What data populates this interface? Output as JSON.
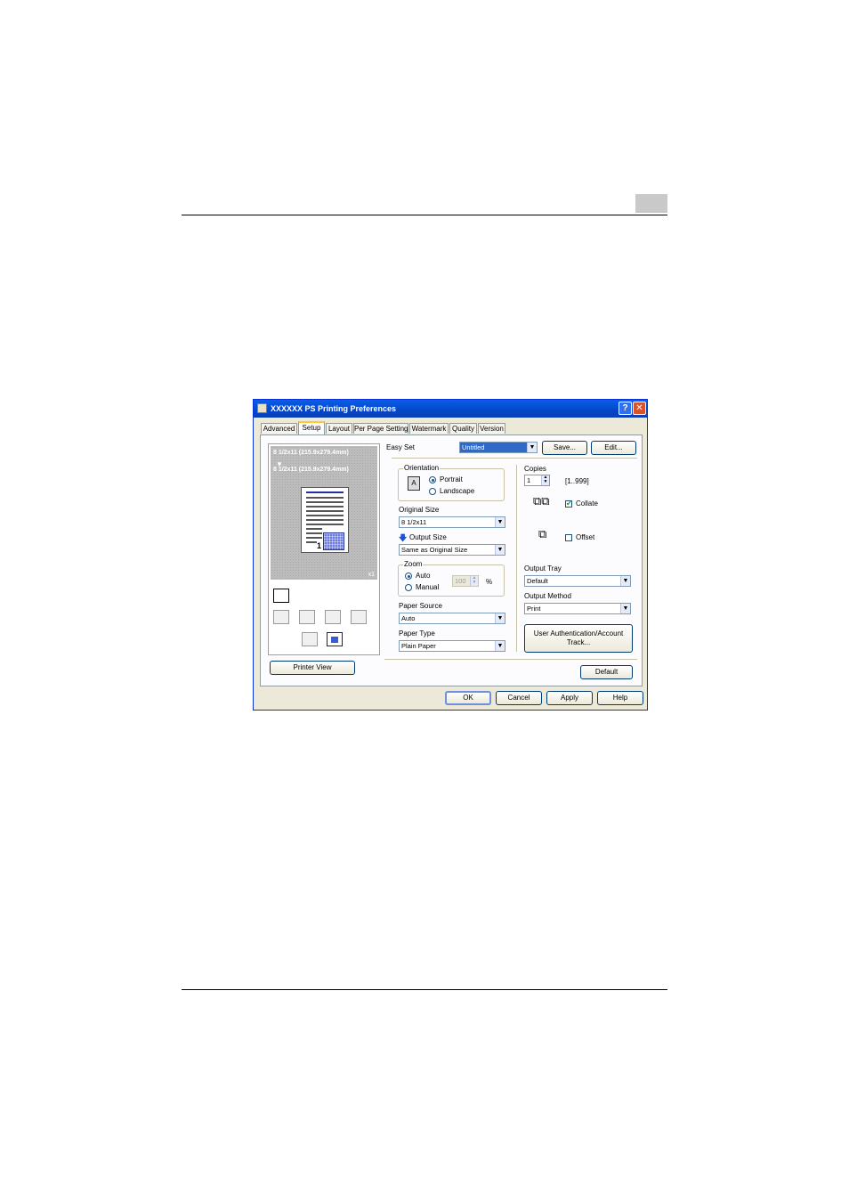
{
  "window": {
    "title": "XXXXXX  PS Printing Preferences",
    "help_button": "?",
    "close_button": "✕"
  },
  "tabs": [
    "Advanced",
    "Setup",
    "Layout",
    "Per Page Setting",
    "Watermark",
    "Quality",
    "Version"
  ],
  "active_tab": "Setup",
  "preview": {
    "original_line": "8 1/2x11 (215.9x279.4mm)",
    "arrow": "▼",
    "output_line": "8 1/2x11 (215.9x279.4mm)",
    "page_number": "1",
    "copies_marker": "x1",
    "printer_view_button": "Printer View"
  },
  "easy_set": {
    "label": "Easy Set",
    "value": "Untitled",
    "save_button": "Save...",
    "edit_button": "Edit..."
  },
  "orientation": {
    "title": "Orientation",
    "icon_letter": "A",
    "options": [
      "Portrait",
      "Landscape"
    ],
    "selected": "Portrait"
  },
  "original_size": {
    "label": "Original Size",
    "value": "8 1/2x11"
  },
  "output_size": {
    "label": "Output Size",
    "value": "Same as Original Size"
  },
  "zoom": {
    "title": "Zoom",
    "options": [
      "Auto",
      "Manual"
    ],
    "selected": "Auto",
    "value": "100",
    "unit": "%"
  },
  "paper_source": {
    "label": "Paper Source",
    "value": "Auto"
  },
  "paper_type": {
    "label": "Paper Type",
    "value": "Plain Paper"
  },
  "copies": {
    "label": "Copies",
    "value": "1",
    "range": "[1..999]"
  },
  "collate": {
    "label": "Collate",
    "checked": true
  },
  "offset": {
    "label": "Offset",
    "checked": false
  },
  "output_tray": {
    "label": "Output Tray",
    "value": "Default"
  },
  "output_method": {
    "label": "Output Method",
    "value": "Print"
  },
  "user_auth_button": {
    "line1": "User Authentication/Account",
    "line2": "Track..."
  },
  "default_button": "Default",
  "footer_buttons": {
    "ok": "OK",
    "cancel": "Cancel",
    "apply": "Apply",
    "help": "Help"
  },
  "colors": {
    "titlebar": "#0a5ee8",
    "dialog_bg": "#ece9d8",
    "selection": "#3169c6",
    "chapter_box": "#c9c9c9"
  }
}
